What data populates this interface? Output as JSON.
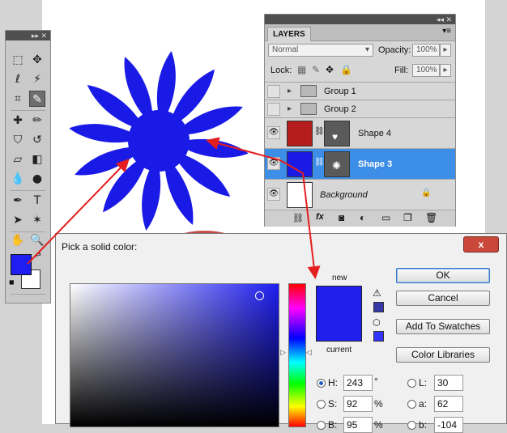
{
  "layers_panel": {
    "tab": "LAYERS",
    "blend_mode": "Normal",
    "opacity_label": "Opacity:",
    "opacity_value": "100%",
    "lock_label": "Lock:",
    "fill_label": "Fill:",
    "fill_value": "100%",
    "layers": [
      {
        "name": "Group 1",
        "kind": "group",
        "visible": false,
        "selected": false
      },
      {
        "name": "Group 2",
        "kind": "group",
        "visible": false,
        "selected": false
      },
      {
        "name": "Shape 4",
        "kind": "shape",
        "visible": true,
        "selected": false,
        "color": "#b51c1c"
      },
      {
        "name": "Shape 3",
        "kind": "shape",
        "visible": true,
        "selected": true,
        "color": "#1a1ae6"
      },
      {
        "name": "Background",
        "kind": "background",
        "visible": true,
        "selected": false
      }
    ]
  },
  "toolbox": {
    "foreground_color": "#1e1ef0",
    "background_color": "#ffffff"
  },
  "color_picker": {
    "title": "Pick a solid color:",
    "close_label": "x",
    "new_label": "new",
    "current_label": "current",
    "new_color": "#2020ee",
    "current_color": "#2020ee",
    "ok_label": "OK",
    "cancel_label": "Cancel",
    "add_swatches_label": "Add To Swatches",
    "color_libraries_label": "Color Libraries",
    "fields": {
      "H": {
        "label": "H:",
        "value": "243",
        "unit": "°"
      },
      "S": {
        "label": "S:",
        "value": "92",
        "unit": "%"
      },
      "B": {
        "label": "B:",
        "value": "95",
        "unit": "%"
      },
      "L": {
        "label": "L:",
        "value": "30"
      },
      "a": {
        "label": "a:",
        "value": "62"
      },
      "b": {
        "label": "b:",
        "value": "-104"
      }
    }
  },
  "canvas": {
    "shape_color": "#1a1ae6"
  }
}
